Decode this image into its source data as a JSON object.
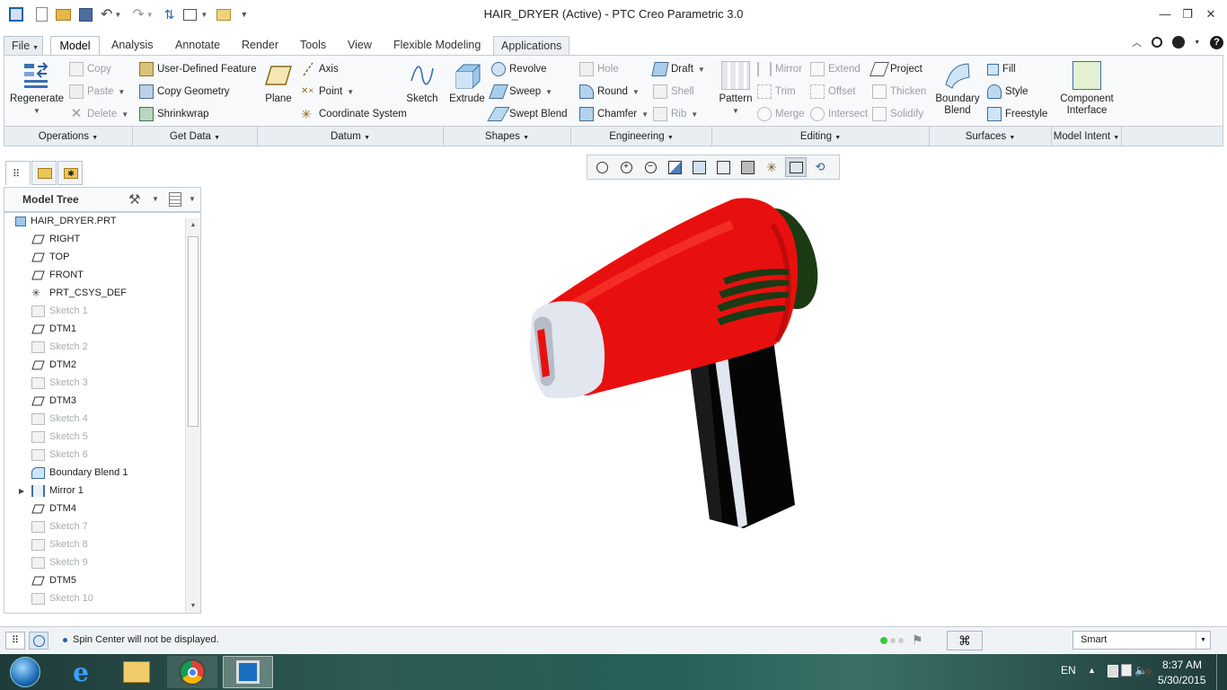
{
  "window": {
    "title": "HAIR_DRYER (Active) - PTC Creo Parametric 3.0"
  },
  "menu_tabs": [
    "File",
    "Model",
    "Analysis",
    "Annotate",
    "Render",
    "Tools",
    "View",
    "Flexible Modeling",
    "Applications"
  ],
  "active_tab": "Model",
  "ribbon": {
    "operations": {
      "regenerate": "Regenerate",
      "copy": "Copy",
      "paste": "Paste",
      "delete": "Delete"
    },
    "get_data": {
      "user_defined_feature": "User-Defined Feature",
      "copy_geometry": "Copy Geometry",
      "shrinkwrap": "Shrinkwrap"
    },
    "datum": {
      "plane": "Plane",
      "axis": "Axis",
      "point": "Point",
      "coordinate_system": "Coordinate System",
      "sketch": "Sketch"
    },
    "shapes": {
      "extrude": "Extrude",
      "revolve": "Revolve",
      "sweep": "Sweep",
      "swept_blend": "Swept Blend"
    },
    "engineering": {
      "hole": "Hole",
      "draft": "Draft",
      "round": "Round",
      "shell": "Shell",
      "chamfer": "Chamfer",
      "rib": "Rib"
    },
    "editing": {
      "pattern": "Pattern",
      "mirror": "Mirror",
      "extend": "Extend",
      "project": "Project",
      "trim": "Trim",
      "offset": "Offset",
      "thicken": "Thicken",
      "merge": "Merge",
      "intersect": "Intersect",
      "solidify": "Solidify"
    },
    "surfaces": {
      "boundary_blend_1": "Boundary",
      "boundary_blend_2": "Blend",
      "fill": "Fill",
      "style": "Style",
      "freestyle": "Freestyle"
    },
    "model_intent": {
      "component_interface_1": "Component",
      "component_interface_2": "Interface"
    },
    "groups": [
      "Operations",
      "Get Data",
      "Datum",
      "Shapes",
      "Engineering",
      "Editing",
      "Surfaces",
      "Model Intent"
    ]
  },
  "model_tree": {
    "header": "Model Tree",
    "items": [
      {
        "label": "HAIR_DRYER.PRT",
        "type": "part",
        "enabled": true
      },
      {
        "label": "RIGHT",
        "type": "plane",
        "enabled": true
      },
      {
        "label": "TOP",
        "type": "plane",
        "enabled": true
      },
      {
        "label": "FRONT",
        "type": "plane",
        "enabled": true
      },
      {
        "label": "PRT_CSYS_DEF",
        "type": "csys",
        "enabled": true
      },
      {
        "label": "Sketch 1",
        "type": "sketch",
        "enabled": false
      },
      {
        "label": "DTM1",
        "type": "plane",
        "enabled": true
      },
      {
        "label": "Sketch 2",
        "type": "sketch",
        "enabled": false
      },
      {
        "label": "DTM2",
        "type": "plane",
        "enabled": true
      },
      {
        "label": "Sketch 3",
        "type": "sketch",
        "enabled": false
      },
      {
        "label": "DTM3",
        "type": "plane",
        "enabled": true
      },
      {
        "label": "Sketch 4",
        "type": "sketch",
        "enabled": false
      },
      {
        "label": "Sketch 5",
        "type": "sketch",
        "enabled": false
      },
      {
        "label": "Sketch 6",
        "type": "sketch",
        "enabled": false
      },
      {
        "label": "Boundary Blend 1",
        "type": "blend",
        "enabled": true
      },
      {
        "label": "Mirror 1",
        "type": "mirror",
        "enabled": true
      },
      {
        "label": "DTM4",
        "type": "plane",
        "enabled": true
      },
      {
        "label": "Sketch 7",
        "type": "sketch",
        "enabled": false
      },
      {
        "label": "Sketch 8",
        "type": "sketch",
        "enabled": false
      },
      {
        "label": "Sketch 9",
        "type": "sketch",
        "enabled": false
      },
      {
        "label": "DTM5",
        "type": "plane",
        "enabled": true
      },
      {
        "label": "Sketch 10",
        "type": "sketch",
        "enabled": false
      }
    ]
  },
  "status": {
    "message": "Spin Center will not be displayed.",
    "filter": "Smart"
  },
  "taskbar": {
    "language": "EN",
    "time": "8:37 AM",
    "date": "5/30/2015"
  },
  "colors": {
    "model_red": "#e8100f",
    "model_dark_green": "#1c3a14",
    "handle_black": "#050505",
    "nozzle_light": "#e2e6ee"
  }
}
